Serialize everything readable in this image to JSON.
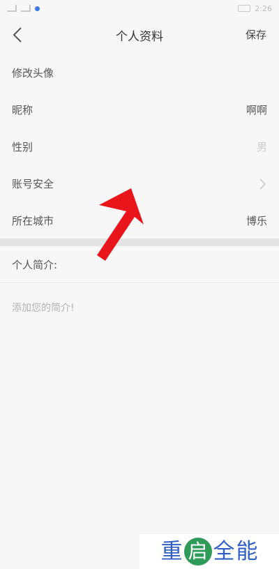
{
  "status_bar": {
    "time": "2:26"
  },
  "header": {
    "title": "个人资料",
    "save_label": "保存"
  },
  "rows": [
    {
      "label": "修改头像",
      "value": ""
    },
    {
      "label": "昵称",
      "value": "啊啊"
    },
    {
      "label": "性别",
      "value": "男"
    },
    {
      "label": "账号安全",
      "value": ""
    },
    {
      "label": "所在城市",
      "value": "博乐"
    }
  ],
  "bio": {
    "label": "个人简介:",
    "placeholder": "添加您的简介!"
  },
  "watermark": {
    "char1": "重",
    "char2": "启",
    "char3": "全",
    "char4": "能"
  },
  "colors": {
    "annotation_arrow": "#e8151b",
    "watermark_blue": "#2f5fc4",
    "watermark_green": "#2e9b59"
  },
  "icons": {
    "back": "chevron-left-icon",
    "row_arrow": "chevron-right-icon",
    "annotation": "red-arrow-annotation"
  }
}
